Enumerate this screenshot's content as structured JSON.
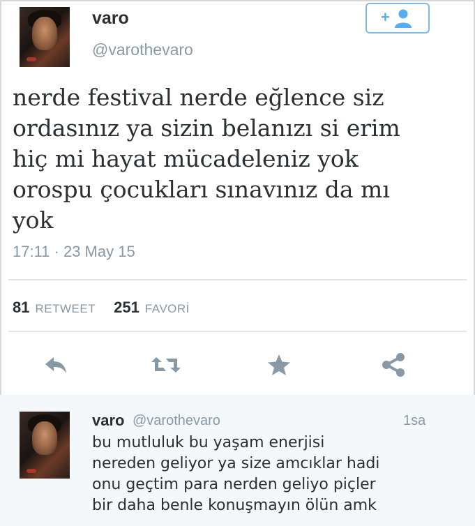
{
  "tweet": {
    "author_name": "varo",
    "author_handle": "@varothevaro",
    "text": "nerde festival nerde eğlence siz\nordasınız ya sizin belanızı si erim\nhiç mi hayat mücadeleniz yok\norospu çocukları sınavınız da mı\nyok",
    "timestamp": "17:11 · 23 May 15",
    "retweet_count": "81",
    "retweet_label": "RETWEET",
    "favorite_count": "251",
    "favorite_label": "FAVORİ"
  },
  "follow_button": {
    "icon": "add-user-icon"
  },
  "actions": [
    {
      "name": "reply",
      "icon": "reply-icon"
    },
    {
      "name": "retweet",
      "icon": "retweet-icon"
    },
    {
      "name": "favorite",
      "icon": "star-icon"
    },
    {
      "name": "share",
      "icon": "share-icon"
    }
  ],
  "reply": {
    "author_name": "varo",
    "author_handle": "@varothevaro",
    "time": "1sa",
    "text": "bu mutluluk bu yaşam enerjisi\nnereden geliyor ya size amcıklar hadi\nonu geçtim para nerden geliyo piçler\nbir daha benle konuşmayın ölün amk"
  },
  "colors": {
    "accent": "#55acee",
    "icon": "#8899a6",
    "text": "#292f33",
    "muted": "#8899a6"
  }
}
